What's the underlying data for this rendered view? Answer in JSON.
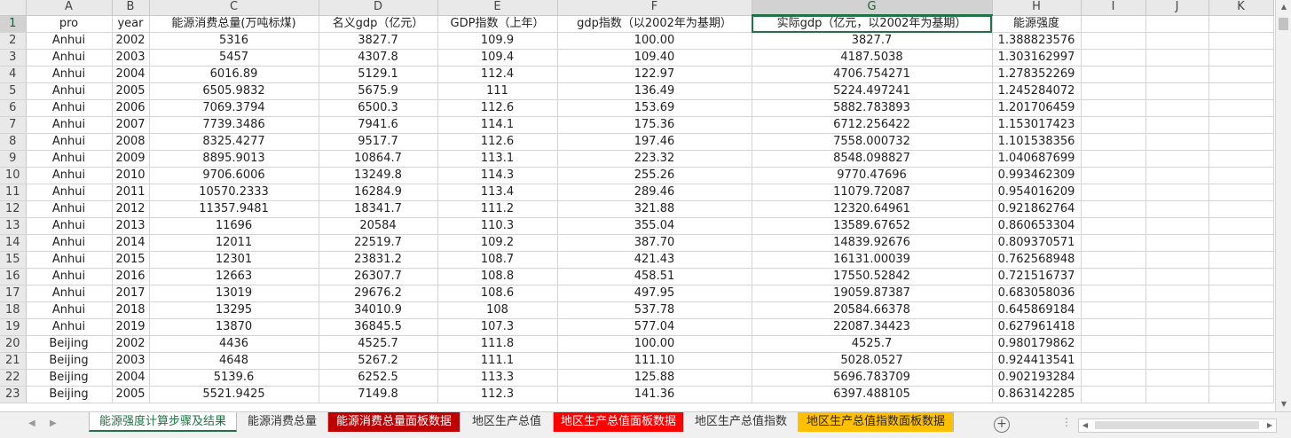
{
  "columns": [
    "A",
    "B",
    "C",
    "D",
    "E",
    "F",
    "G",
    "H",
    "I",
    "J",
    "K"
  ],
  "selected_cell": "G1",
  "headers": [
    "pro",
    "year",
    "能源消费总量(万吨标煤)",
    "名义gdp（亿元）",
    "GDP指数（上年）",
    "gdp指数（以2002年为基期）",
    "实际gdp（亿元，以2002年为基期）",
    "能源强度"
  ],
  "rows": [
    [
      "Anhui",
      "2002",
      "5316",
      "3827.7",
      "109.9",
      "100.00",
      "3827.7",
      "1.388823576"
    ],
    [
      "Anhui",
      "2003",
      "5457",
      "4307.8",
      "109.4",
      "109.40",
      "4187.5038",
      "1.303162997"
    ],
    [
      "Anhui",
      "2004",
      "6016.89",
      "5129.1",
      "112.4",
      "122.97",
      "4706.754271",
      "1.278352269"
    ],
    [
      "Anhui",
      "2005",
      "6505.9832",
      "5675.9",
      "111",
      "136.49",
      "5224.497241",
      "1.245284072"
    ],
    [
      "Anhui",
      "2006",
      "7069.3794",
      "6500.3",
      "112.6",
      "153.69",
      "5882.783893",
      "1.201706459"
    ],
    [
      "Anhui",
      "2007",
      "7739.3486",
      "7941.6",
      "114.1",
      "175.36",
      "6712.256422",
      "1.153017423"
    ],
    [
      "Anhui",
      "2008",
      "8325.4277",
      "9517.7",
      "112.6",
      "197.46",
      "7558.000732",
      "1.101538356"
    ],
    [
      "Anhui",
      "2009",
      "8895.9013",
      "10864.7",
      "113.1",
      "223.32",
      "8548.098827",
      "1.040687699"
    ],
    [
      "Anhui",
      "2010",
      "9706.6006",
      "13249.8",
      "114.3",
      "255.26",
      "9770.47696",
      "0.993462309"
    ],
    [
      "Anhui",
      "2011",
      "10570.2333",
      "16284.9",
      "113.4",
      "289.46",
      "11079.72087",
      "0.954016209"
    ],
    [
      "Anhui",
      "2012",
      "11357.9481",
      "18341.7",
      "111.2",
      "321.88",
      "12320.64961",
      "0.921862764"
    ],
    [
      "Anhui",
      "2013",
      "11696",
      "20584",
      "110.3",
      "355.04",
      "13589.67652",
      "0.860653304"
    ],
    [
      "Anhui",
      "2014",
      "12011",
      "22519.7",
      "109.2",
      "387.70",
      "14839.92676",
      "0.809370571"
    ],
    [
      "Anhui",
      "2015",
      "12301",
      "23831.2",
      "108.7",
      "421.43",
      "16131.00039",
      "0.762568948"
    ],
    [
      "Anhui",
      "2016",
      "12663",
      "26307.7",
      "108.8",
      "458.51",
      "17550.52842",
      "0.721516737"
    ],
    [
      "Anhui",
      "2017",
      "13019",
      "29676.2",
      "108.6",
      "497.95",
      "19059.87387",
      "0.683058036"
    ],
    [
      "Anhui",
      "2018",
      "13295",
      "34010.9",
      "108",
      "537.78",
      "20584.66378",
      "0.645869184"
    ],
    [
      "Anhui",
      "2019",
      "13870",
      "36845.5",
      "107.3",
      "577.04",
      "22087.34423",
      "0.627961418"
    ],
    [
      "Beijing",
      "2002",
      "4436",
      "4525.7",
      "111.8",
      "100.00",
      "4525.7",
      "0.980179862"
    ],
    [
      "Beijing",
      "2003",
      "4648",
      "5267.2",
      "111.1",
      "111.10",
      "5028.0527",
      "0.924413541"
    ],
    [
      "Beijing",
      "2004",
      "5139.6",
      "6252.5",
      "113.3",
      "125.88",
      "5696.783709",
      "0.902193284"
    ],
    [
      "Beijing",
      "2005",
      "5521.9425",
      "7149.8",
      "112.3",
      "141.36",
      "6397.488105",
      "0.863142285"
    ]
  ],
  "tabs": [
    {
      "label": "能源强度计算步骤及结果",
      "style": "active"
    },
    {
      "label": "能源消费总量",
      "style": "plain"
    },
    {
      "label": "能源消费总量面板数据",
      "style": "red"
    },
    {
      "label": "地区生产总值",
      "style": "plain"
    },
    {
      "label": "地区生产总值面板数据",
      "style": "red2"
    },
    {
      "label": "地区生产总值指数",
      "style": "plain"
    },
    {
      "label": "地区生产总值指数面板数据",
      "style": "gold"
    }
  ],
  "icons": {
    "prev_sheet": "chevron-left-icon",
    "next_sheet": "chevron-right-icon",
    "add_sheet": "plus-circle-icon"
  }
}
